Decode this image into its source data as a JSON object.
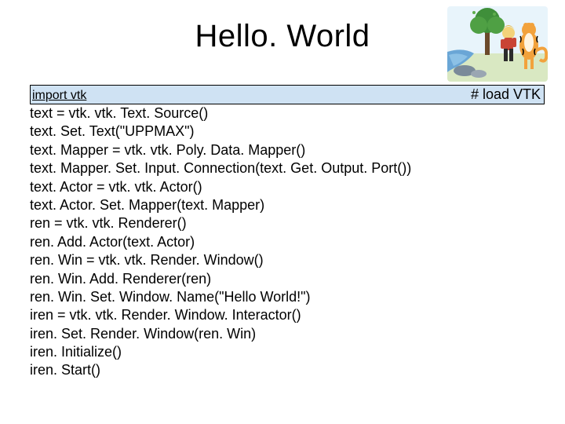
{
  "title": "Hello. World",
  "first_line_left": "import vtk",
  "first_line_right": "# load VTK",
  "code_lines": [
    "text = vtk. vtk. Text. Source()",
    "text. Set. Text(\"UPPMAX\")",
    "text. Mapper = vtk. vtk. Poly. Data. Mapper()",
    "text. Mapper. Set. Input. Connection(text. Get. Output. Port())",
    "text. Actor = vtk. vtk. Actor()",
    "text. Actor. Set. Mapper(text. Mapper)",
    "ren = vtk. vtk. Renderer()",
    "ren. Add. Actor(text. Actor)",
    "ren. Win = vtk. vtk. Render. Window()",
    "ren. Win. Add. Renderer(ren)",
    "ren. Win. Set. Window. Name(\"Hello World!\")",
    "iren = vtk. vtk. Render. Window. Interactor()",
    "iren. Set. Render. Window(ren. Win)",
    "iren. Initialize()",
    "iren. Start()"
  ]
}
